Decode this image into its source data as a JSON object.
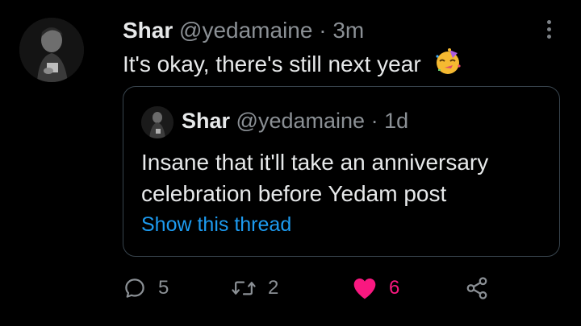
{
  "tweet": {
    "author": {
      "name": "Shar",
      "handle": "@yedamaine"
    },
    "separator": "·",
    "time": "3m",
    "text": "It's okay, there's still next year",
    "emoji": "partying-face-emoji"
  },
  "quoted": {
    "author": {
      "name": "Shar",
      "handle": "@yedamaine"
    },
    "separator": "·",
    "time": "1d",
    "text": "Insane that it'll take an anniversary celebration before Yedam post",
    "link": "Show this thread"
  },
  "actions": {
    "reply": {
      "icon": "reply-icon",
      "count": "5"
    },
    "retweet": {
      "icon": "retweet-icon",
      "count": "2"
    },
    "like": {
      "icon": "heart-icon",
      "count": "6",
      "liked": true,
      "color": "#f91880"
    },
    "share": {
      "icon": "share-icon"
    }
  },
  "colors": {
    "background": "#000000",
    "text": "#e7e9ea",
    "muted": "#8b9095",
    "link": "#1d9bf0",
    "border": "#38444d",
    "like": "#f91880"
  }
}
